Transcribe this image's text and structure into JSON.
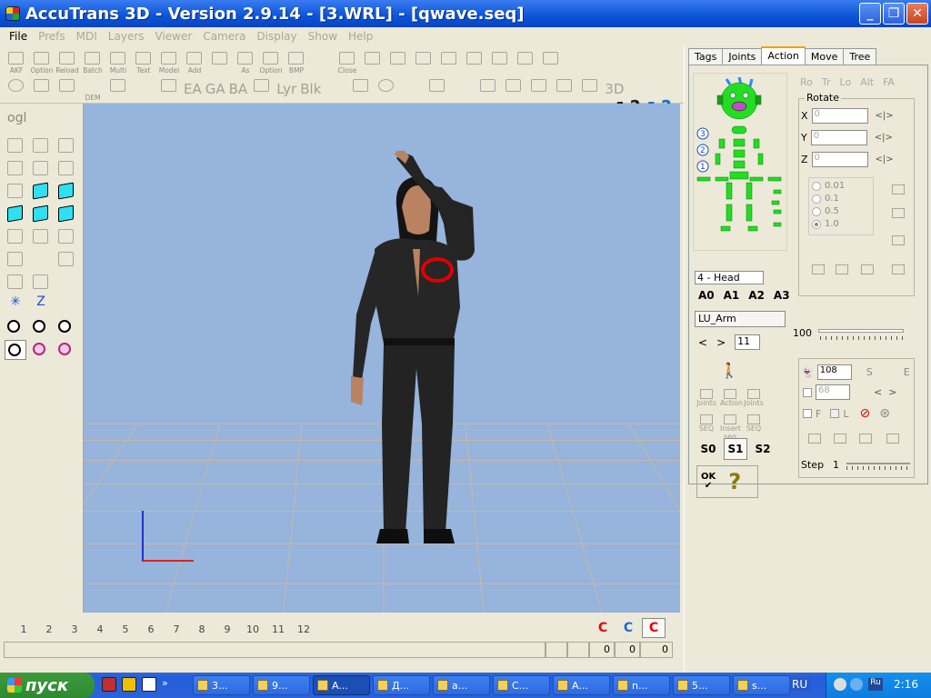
{
  "window": {
    "title": "AccuTrans 3D - Version 2.9.14 - [3.WRL] - [qwave.seq]"
  },
  "menu": [
    "File",
    "Prefs",
    "MDI",
    "Layers",
    "Viewer",
    "Camera",
    "Display",
    "Show",
    "Help"
  ],
  "toolbar": {
    "row1_labels": [
      "AKF",
      "Option",
      "Reload",
      "Batch",
      "Multi",
      "Text",
      "Model",
      "Add",
      "",
      "As",
      "Option",
      "BMP",
      "",
      "Close"
    ],
    "row2_text": [
      "EA",
      "GA",
      "BA",
      "DEM",
      "Lyr",
      "Blk",
      "3D"
    ]
  },
  "left_tools": {
    "ogl_label": "ogl"
  },
  "right_panel": {
    "tabs": [
      "Tags",
      "Joints",
      "Action",
      "Move",
      "Tree"
    ],
    "active_tab": "Action",
    "head_label": "4 - Head",
    "action_sets": [
      "A0",
      "A1",
      "A2",
      "A3"
    ],
    "selected_joint": "LU_Arm",
    "frame_value": "11",
    "seq_buttons": [
      "Joints",
      "Action",
      "Joints",
      "SEQ",
      "Insert seq",
      "SEQ"
    ],
    "s_buttons": [
      "S0",
      "S1",
      "S2"
    ],
    "active_s": "S1",
    "ok_label": "OK",
    "help_glyph": "?",
    "ro_tabs": [
      "Ro",
      "Tr",
      "Lo",
      "Alt",
      "FA"
    ],
    "rotate_title": "Rotate",
    "axes": [
      {
        "label": "X",
        "value": "0"
      },
      {
        "label": "Y",
        "value": "0"
      },
      {
        "label": "Z",
        "value": "0"
      }
    ],
    "steps": [
      "0.01",
      "0.1",
      "0.5",
      "1.0"
    ],
    "checked_step": "1.0",
    "slider_value": "100",
    "frame_fields": {
      "current": "108",
      "end": "68"
    },
    "s_label": "S",
    "e_label": "E",
    "f_label": "F",
    "l_label": "L",
    "step_label": "Step",
    "step_value": "1"
  },
  "status": {
    "frames": [
      "1",
      "2",
      "3",
      "4",
      "5",
      "6",
      "7",
      "8",
      "9",
      "10",
      "11",
      "12"
    ],
    "values": [
      "0",
      "0",
      "0"
    ]
  },
  "taskbar": {
    "start": "пуск",
    "tasks": [
      "3...",
      "9...",
      "A...",
      "Д...",
      "a...",
      "C...",
      "A...",
      "n...",
      "5...",
      "s..."
    ],
    "lang": "RU",
    "time": "2:16"
  },
  "colors": {
    "viewport": "#96b4dc",
    "skeleton": "#22dd22",
    "marker": "#e00000",
    "title": "#0a54d8"
  }
}
